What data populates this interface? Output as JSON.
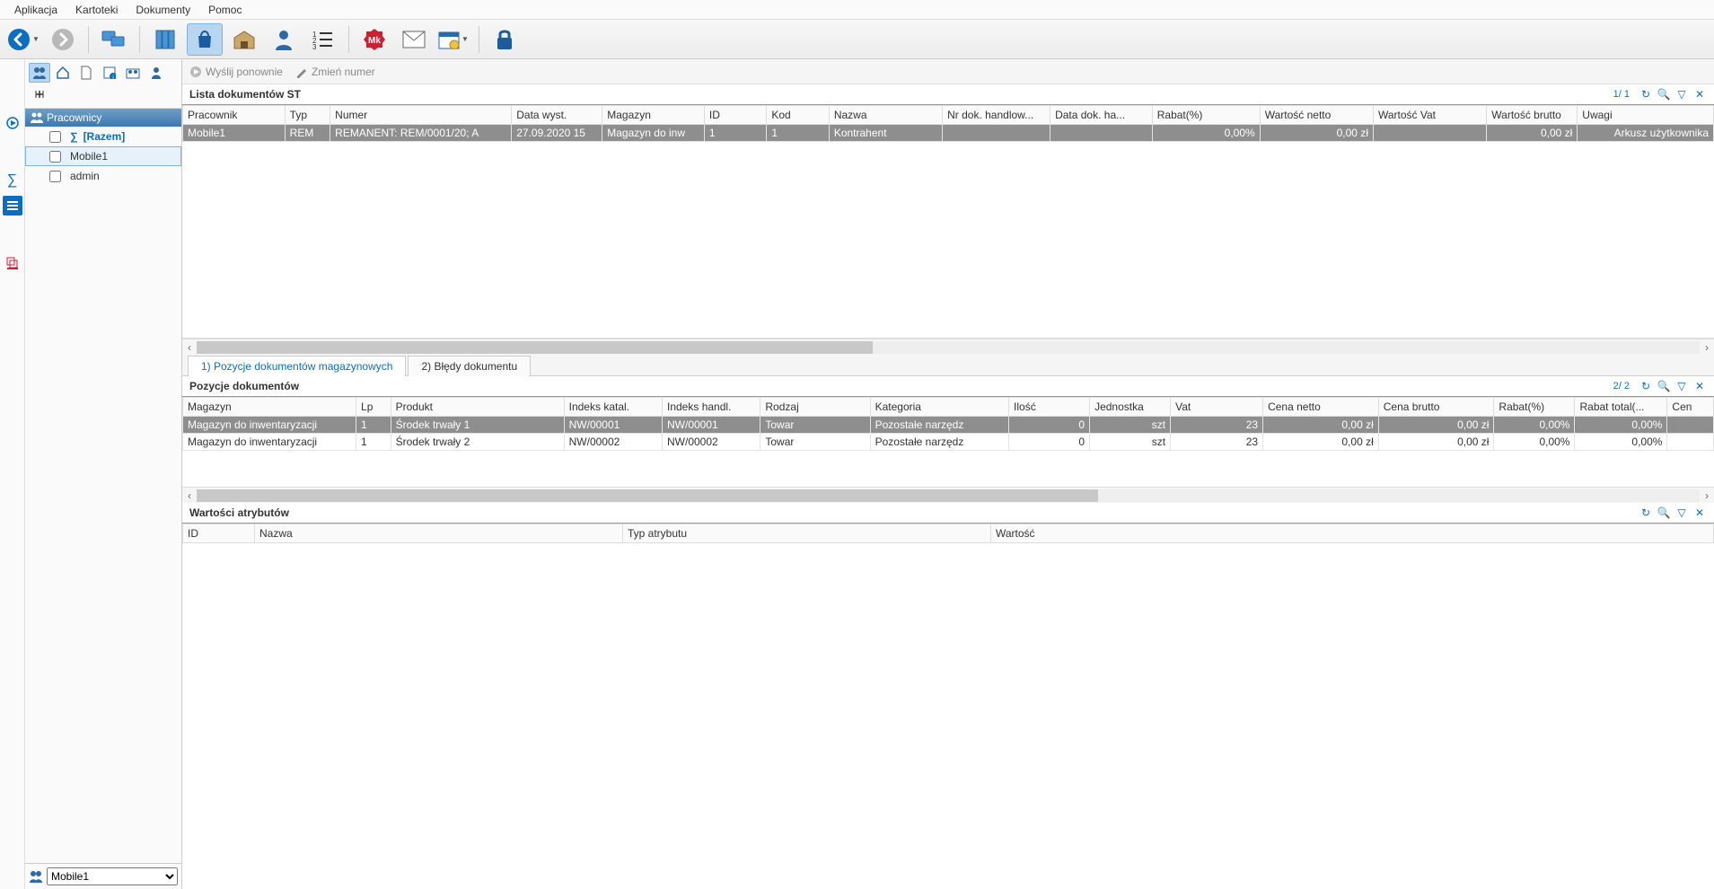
{
  "menubar": [
    "Aplikacja",
    "Kartoteki",
    "Dokumenty",
    "Pomoc"
  ],
  "sidebar": {
    "header": "Pracownicy",
    "items": [
      {
        "label": "[Razem]",
        "sum": true,
        "selected": false
      },
      {
        "label": "Mobile1",
        "sum": false,
        "selected": true
      },
      {
        "label": "admin",
        "sum": false,
        "selected": false
      }
    ],
    "footer_selected": "Mobile1"
  },
  "actions": {
    "send_again": "Wyślij ponownie",
    "change_number": "Zmień numer"
  },
  "documents": {
    "title": "Lista dokumentów ST",
    "page": "1/ 1",
    "columns": [
      "Pracownik",
      "Typ",
      "Numer",
      "Data wyst.",
      "Magazyn",
      "ID",
      "Kod",
      "Nazwa",
      "Nr dok. handlow...",
      "Data dok. ha...",
      "Rabat(%)",
      "Wartość netto",
      "Wartość Vat",
      "Wartość brutto",
      "Uwagi"
    ],
    "rows": [
      {
        "cells": [
          "Mobile1",
          "REM",
          "REMANENT: REM/0001/20; A",
          "27.09.2020 15",
          "Magazyn do inw",
          "1",
          "1",
          "Kontrahent",
          "",
          "",
          "0,00%",
          "0,00 zł",
          "",
          "0,00 zł",
          "Arkusz użytkownika"
        ],
        "selected": true
      }
    ]
  },
  "tabs": [
    {
      "label": "1) Pozycje dokumentów magazynowych",
      "active": true
    },
    {
      "label": "2) Błędy dokumentu",
      "active": false
    }
  ],
  "positions": {
    "title": "Pozycje dokumentów",
    "page": "2/ 2",
    "columns": [
      "Magazyn",
      "Lp",
      "Produkt",
      "Indeks katal.",
      "Indeks handl.",
      "Rodzaj",
      "Kategoria",
      "Ilość",
      "Jednostka",
      "Vat",
      "Cena netto",
      "Cena brutto",
      "Rabat(%)",
      "Rabat total(...",
      "Cen"
    ],
    "rows": [
      {
        "cells": [
          "Magazyn do inwentaryzacji",
          "1",
          "Środek trwały 1",
          "NW/00001",
          "NW/00001",
          "Towar",
          "Pozostałe narzędz",
          "0",
          "szt",
          "23",
          "0,00 zł",
          "0,00 zł",
          "0,00%",
          "0,00%",
          ""
        ],
        "selected": true
      },
      {
        "cells": [
          "Magazyn do inwentaryzacji",
          "1",
          "Środek trwały 2",
          "NW/00002",
          "NW/00002",
          "Towar",
          "Pozostałe narzędz",
          "0",
          "szt",
          "23",
          "0,00 zł",
          "0,00 zł",
          "0,00%",
          "0,00%",
          ""
        ],
        "selected": false
      }
    ]
  },
  "attributes": {
    "title": "Wartości atrybutów",
    "columns": [
      "ID",
      "Nazwa",
      "Typ atrybutu",
      "Wartość"
    ]
  }
}
